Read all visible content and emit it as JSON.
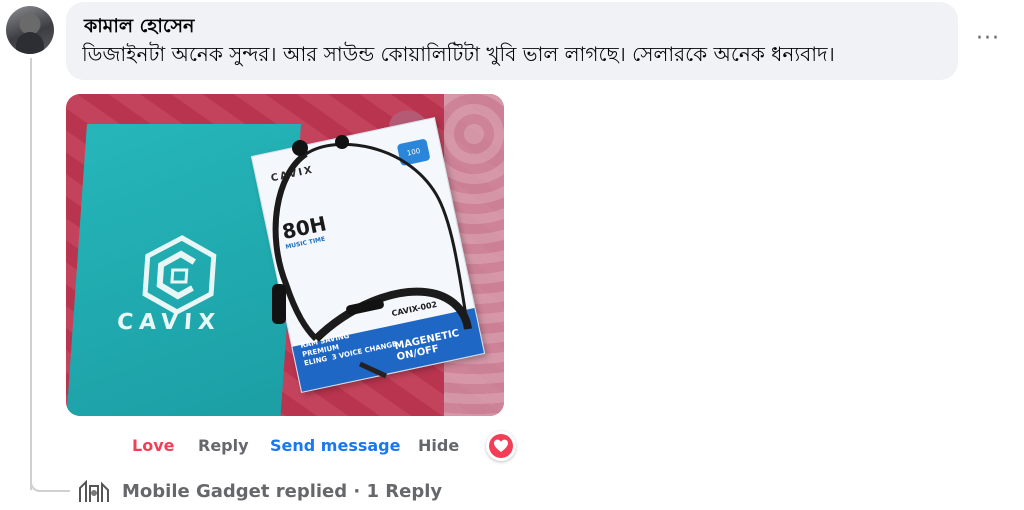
{
  "comment": {
    "author": "কামাল হোসেন",
    "text": "ডিজাইনটা অনেক সুন্দর। আর সাউন্ড কোয়ালিটিটা খুবি ভাল লাগছে। সেলারকে অনেক ধন্যবাদ।",
    "more_label": "···"
  },
  "photo": {
    "bag_brand": "CAVIX",
    "box_brand": "CAVIX",
    "box_hours": "80H",
    "box_hours_sub": "MUSIC TIME",
    "box_badge": "100",
    "box_model": "CAVIX-002",
    "box_feature": "MAGENETIC ON/OFF",
    "box_feature_small": "RAM SAVING\nPREMIUM\nELING  3 VOICE CHANGE"
  },
  "actions": {
    "love": "Love",
    "reply": "Reply",
    "send_message": "Send message",
    "hide": "Hide",
    "reaction": "heart-icon",
    "love_color": "#f33e58",
    "send_color": "#1877f2"
  },
  "replies": {
    "text": "Mobile Gadget replied · 1 Reply"
  }
}
